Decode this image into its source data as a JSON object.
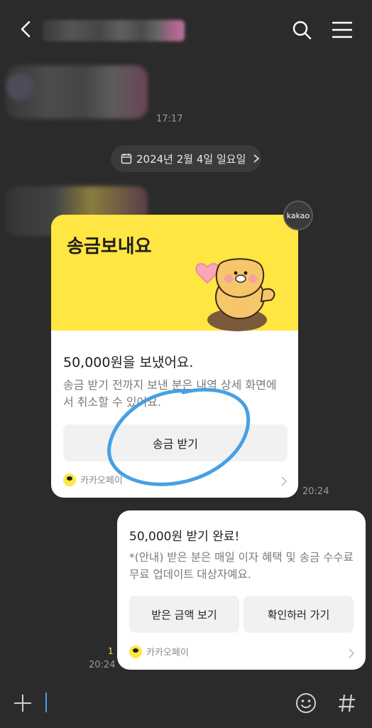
{
  "header": {
    "back_icon": "back-arrow-icon",
    "search_icon": "search-icon",
    "menu_icon": "menu-icon"
  },
  "messages": {
    "time_1": "17:17",
    "date_divider": "2024년 2월 4일 일요일",
    "kakao_badge": "kakao",
    "transfer_card": {
      "title": "송금보내요",
      "amount_text": "50,000원을 보냈어요.",
      "description": "송금 받기 전까지 보낸 분은 내역 상세 화면에서 취소할 수 있어요.",
      "button": "송금 받기",
      "brand": "카카오페이",
      "time": "20:24"
    },
    "received_card": {
      "title": "50,000원 받기 완료!",
      "description": "*(안내) 받은 분은 매일 이자 혜택 및 송금 수수료 무료 업데이트 대상자예요.",
      "button_view": "받은 금액 보기",
      "button_confirm": "확인하러 가기",
      "brand": "카카오페이",
      "unread": "1",
      "time": "20:24"
    }
  },
  "colors": {
    "background": "#2b2b2b",
    "kakao_yellow": "#ffe642",
    "annotation_blue": "#3d9be0"
  }
}
